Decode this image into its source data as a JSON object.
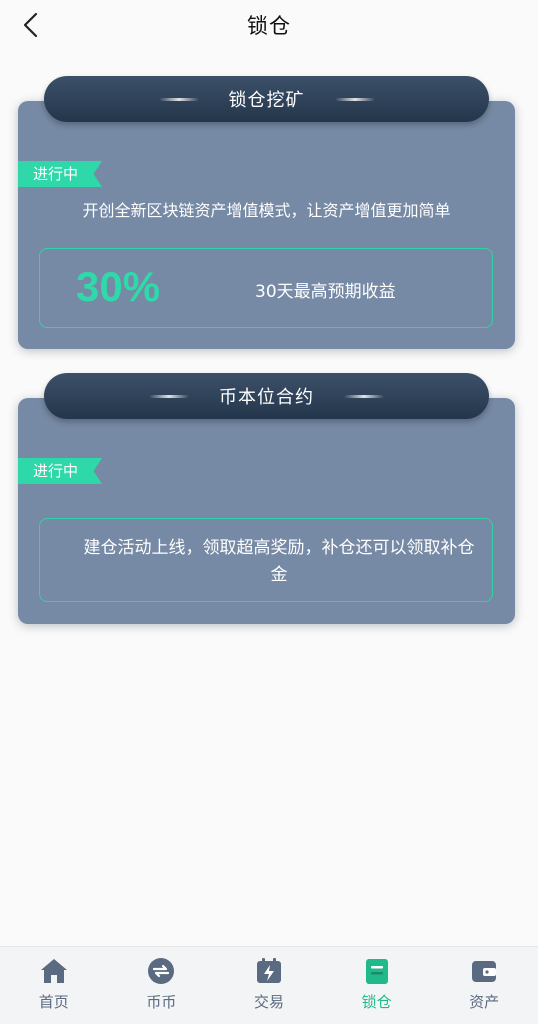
{
  "header": {
    "title": "锁仓"
  },
  "cards": [
    {
      "banner_title": "锁仓挖矿",
      "status": "进行中",
      "description": "开创全新区块链资产增值模式，让资产增值更加简单",
      "rate": "30%",
      "rate_caption": "30天最高预期收益"
    },
    {
      "banner_title": "币本位合约",
      "status": "进行中",
      "body": "建仓活动上线，领取超高奖励，补仓还可以领取补仓金"
    }
  ],
  "nav": {
    "items": [
      {
        "label": "首页",
        "icon": "home-icon"
      },
      {
        "label": "币币",
        "icon": "exchange-icon"
      },
      {
        "label": "交易",
        "icon": "trade-icon"
      },
      {
        "label": "锁仓",
        "icon": "lock-position-icon",
        "active": true
      },
      {
        "label": "资产",
        "icon": "wallet-icon"
      }
    ],
    "active_color": "#22b98a",
    "inactive_color": "#5a6a80"
  },
  "colors": {
    "card": "#7689a5",
    "banner": "#2c3f56",
    "accent": "#2fd9a9"
  }
}
